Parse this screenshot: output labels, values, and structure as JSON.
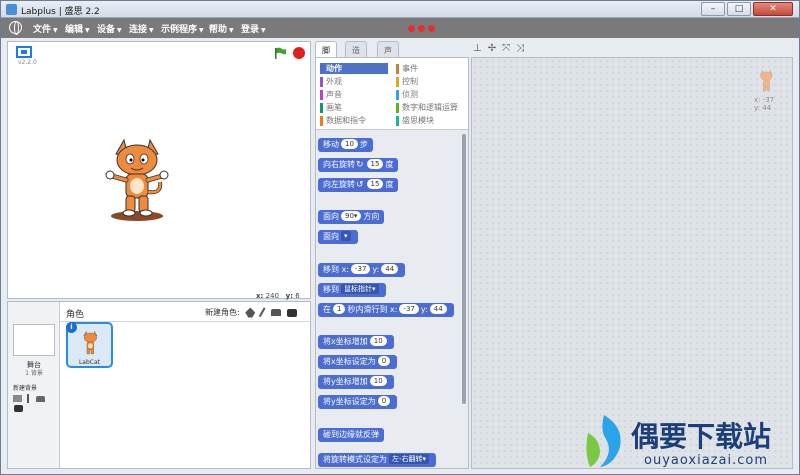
{
  "window": {
    "title": "Labplus | 盛思 2.2",
    "minimize": "–",
    "maximize": "□",
    "close": "✕"
  },
  "menu": [
    {
      "label": "文件"
    },
    {
      "label": "编辑"
    },
    {
      "label": "设备"
    },
    {
      "label": "连接"
    },
    {
      "label": "示例程序"
    },
    {
      "label": "帮助"
    },
    {
      "label": "登录"
    }
  ],
  "stage": {
    "version": "v2.2.0",
    "coord_x_label": "x:",
    "coord_x": "240",
    "coord_y_label": "y:",
    "coord_y": "6"
  },
  "sprites": {
    "title": "角色",
    "new_sprite_label": "新建角色:",
    "stage_label": "舞台",
    "stage_sub": "1 背景",
    "new_backdrop_label": "新建背景",
    "sprite_name": "LabCat",
    "info": "i"
  },
  "tabs": [
    {
      "label": "脚本"
    },
    {
      "label": "造型"
    },
    {
      "label": "声音"
    }
  ],
  "tool_icons": [
    "stamp-icon",
    "cut-icon",
    "grow-icon",
    "shrink-icon"
  ],
  "categories": [
    {
      "label": "动作",
      "color": "#4a6cd4"
    },
    {
      "label": "事件",
      "color": "#c88330"
    },
    {
      "label": "外观",
      "color": "#8a55d7"
    },
    {
      "label": "控制",
      "color": "#e1a91a"
    },
    {
      "label": "声音",
      "color": "#bb42c3"
    },
    {
      "label": "侦测",
      "color": "#2ca5e2"
    },
    {
      "label": "画笔",
      "color": "#0e9a6c"
    },
    {
      "label": "数字和逻辑运算",
      "color": "#5cb712"
    },
    {
      "label": "数据和指令",
      "color": "#ee7d16"
    },
    {
      "label": "盛思模块",
      "color": "#11b89a"
    }
  ],
  "blocks": {
    "move": {
      "pre": "移动",
      "val": "10",
      "post": "步"
    },
    "turn_right": {
      "pre": "向右旋转",
      "val": "15",
      "post": "度"
    },
    "turn_left": {
      "pre": "向左旋转",
      "val": "15",
      "post": "度"
    },
    "point_dir": {
      "pre": "面向",
      "val": "90▾",
      "post": "方向"
    },
    "point_to": {
      "pre": "面向",
      "drop": "▾"
    },
    "goto_xy": {
      "pre": "移到",
      "x_label": "x:",
      "x": "-37",
      "y_label": "y:",
      "y": "44"
    },
    "goto": {
      "pre": "移到",
      "drop": "鼠标指针▾"
    },
    "glide": {
      "pre": "在",
      "val": "1",
      "mid": "秒内滑行到",
      "x_label": "x:",
      "x": "-37",
      "y_label": "y:",
      "y": "44"
    },
    "change_x": {
      "pre": "将x坐标增加",
      "val": "10"
    },
    "set_x": {
      "pre": "将x坐标设定为",
      "val": "0"
    },
    "change_y": {
      "pre": "将y坐标增加",
      "val": "10"
    },
    "set_y": {
      "pre": "将y坐标设定为",
      "val": "0"
    },
    "bounce": {
      "pre": "碰到边缘就反弹"
    },
    "rotation": {
      "pre": "将旋转模式设定为",
      "drop": "左-右翻转▾"
    }
  },
  "script_sprite": {
    "x_label": "x:",
    "x": "-37",
    "y_label": "y:",
    "y": "44"
  },
  "watermark": {
    "main": "偶要下载站",
    "sub": "ouyaoxiazai.com"
  }
}
